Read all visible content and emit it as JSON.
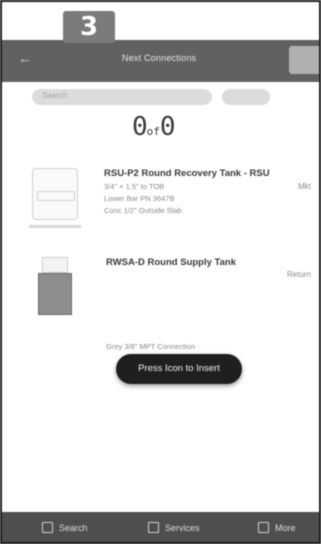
{
  "step_badge": "3",
  "top_bar": {
    "back_icon": "back-arrow-icon",
    "title": "Next Connections"
  },
  "search": {
    "text": "Search"
  },
  "counter": {
    "value": "0",
    "middle": "of",
    "total": "0"
  },
  "items": [
    {
      "title": "RSU-P2 Round Recovery Tank - RSU",
      "line1": "3/4\" × 1.5\" to TOB",
      "line2": "Lower Bar PN 3647B",
      "line3": "Conc 1/2\" Outside Slab",
      "aside": "Mkt"
    },
    {
      "title": "RWSA-D Round Supply Tank",
      "line1": "Return",
      "toast": "Press Icon to Insert",
      "line3": "Grey 3/8\" MPT Connection"
    }
  ],
  "bottom": {
    "tabs": [
      {
        "label": "Search",
        "icon": "search-icon"
      },
      {
        "label": "Services",
        "icon": "services-icon"
      },
      {
        "label": "More",
        "icon": "more-icon"
      }
    ]
  }
}
